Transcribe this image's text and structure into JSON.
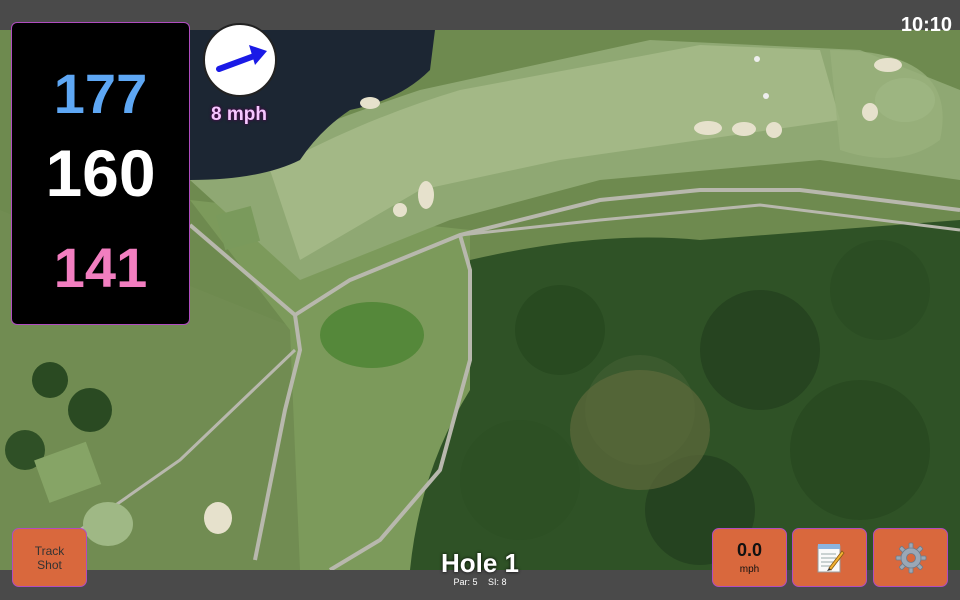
{
  "status_bar": {
    "time": "10:10"
  },
  "distances": {
    "back": "177",
    "middle": "160",
    "front": "141"
  },
  "wind": {
    "speed_label": "8 mph",
    "icon": "wind-direction-arrow-icon"
  },
  "hole": {
    "title": "Hole 1",
    "par": "Par: 5",
    "stroke_index": "SI: 8"
  },
  "buttons": {
    "track_shot_line1": "Track",
    "track_shot_line2": "Shot",
    "speed_value": "0.0",
    "speed_unit": "mph",
    "notes_icon": "notepad-icon",
    "settings_icon": "gear-icon"
  },
  "colors": {
    "back_distance": "#5ea7f4",
    "middle_distance": "#ffffff",
    "front_distance": "#f27ec0",
    "button": "#d9683d",
    "accent_border": "#b04cc0",
    "wind_arrow": "#1a1ae6"
  }
}
